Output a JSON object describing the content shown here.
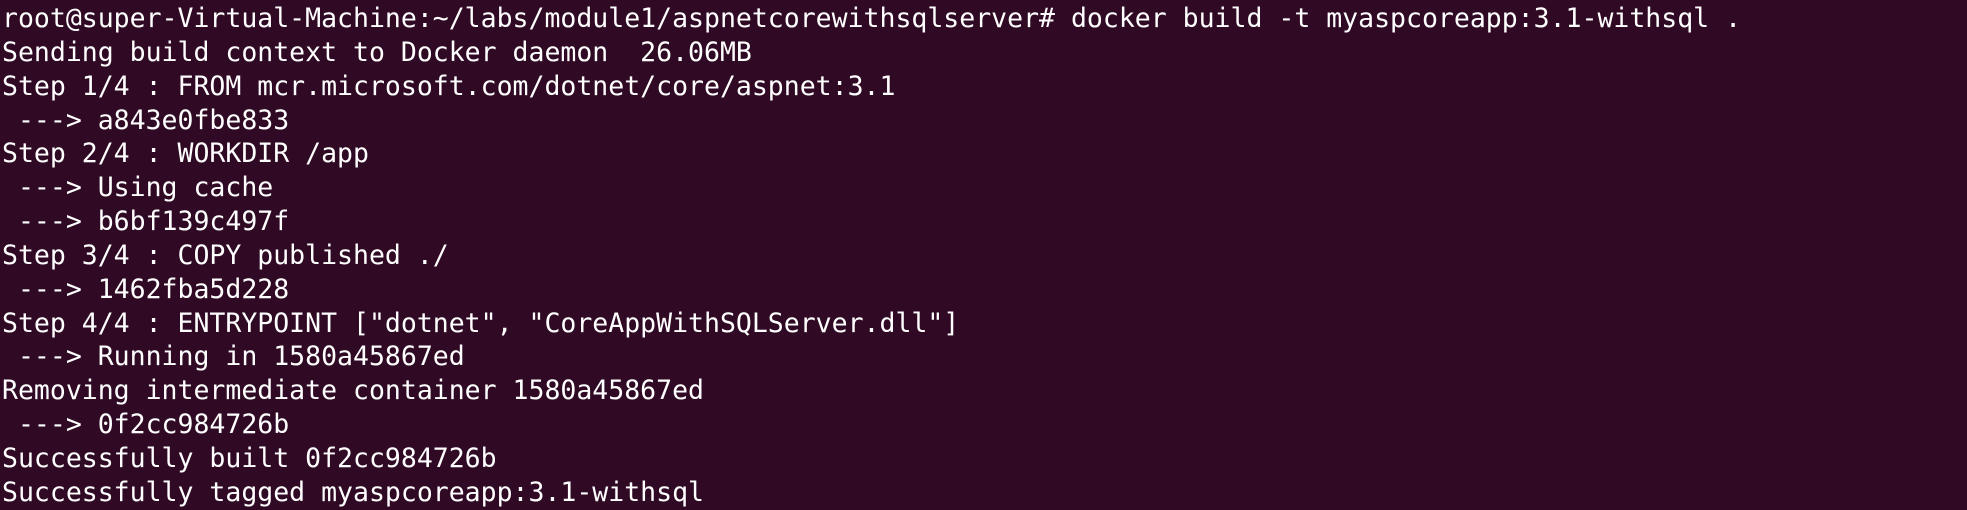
{
  "terminal": {
    "prompt": "root@super-Virtual-Machine:~/labs/module1/aspnetcorewithsqlserver#",
    "command": " docker build -t myaspcoreapp:3.1-withsql .",
    "output": [
      "Sending build context to Docker daemon  26.06MB",
      "Step 1/4 : FROM mcr.microsoft.com/dotnet/core/aspnet:3.1",
      " ---> a843e0fbe833",
      "Step 2/4 : WORKDIR /app",
      " ---> Using cache",
      " ---> b6bf139c497f",
      "Step 3/4 : COPY published ./",
      " ---> 1462fba5d228",
      "Step 4/4 : ENTRYPOINT [\"dotnet\", \"CoreAppWithSQLServer.dll\"]",
      " ---> Running in 1580a45867ed",
      "Removing intermediate container 1580a45867ed",
      " ---> 0f2cc984726b",
      "Successfully built 0f2cc984726b",
      "Successfully tagged myaspcoreapp:3.1-withsql"
    ]
  },
  "colors": {
    "background": "#300a24",
    "foreground": "#ffffff"
  }
}
